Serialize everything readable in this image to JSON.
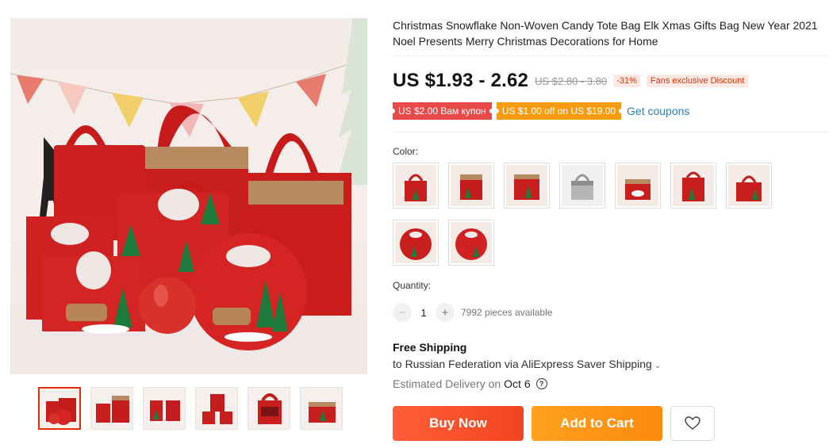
{
  "product": {
    "title": "Christmas Snowflake Non-Woven Candy Tote Bag Elk Xmas Gifts Bag New Year 2021 Noel Presents Merry Christmas Decorations for Home"
  },
  "gallery": {
    "main_image_alt": "red-felt-christmas-tote-bags-photo",
    "thumbnails": [
      {
        "name": "thumb-1",
        "active": true
      },
      {
        "name": "thumb-2",
        "active": false
      },
      {
        "name": "thumb-3",
        "active": false
      },
      {
        "name": "thumb-4",
        "active": false
      },
      {
        "name": "thumb-5",
        "active": false
      },
      {
        "name": "thumb-6",
        "active": false
      }
    ]
  },
  "pricing": {
    "current": "US $1.93 - 2.62",
    "original": "US $2.80 - 3.80",
    "discount": "-31%",
    "fans_badge": "Fans exclusive Discount"
  },
  "coupons": {
    "coupon_1": "US $2.00 Вам купон",
    "coupon_2": "US $1.00 off on US $19.00",
    "get_coupons": "Get coupons"
  },
  "color": {
    "label": "Color:",
    "options_count": 9
  },
  "quantity": {
    "label": "Quantity:",
    "minus": "−",
    "value": "1",
    "plus": "+",
    "available": "7992 pieces available"
  },
  "shipping": {
    "title": "Free Shipping",
    "to": "to Russian Federation via AliExpress Saver Shipping",
    "delivery_label": "Estimated Delivery on",
    "delivery_date": "Oct 6",
    "help_glyph": "?"
  },
  "actions": {
    "buy_now": "Buy Now",
    "add_to_cart": "Add to Cart"
  },
  "colors": {
    "accent_red": "#e62e04",
    "buy_now": "#f2451f",
    "add_to_cart": "#fb8a0c",
    "coupon_red": "#e84a4a",
    "coupon_orange": "#f99b0f",
    "link_blue": "#2e7fb6"
  }
}
